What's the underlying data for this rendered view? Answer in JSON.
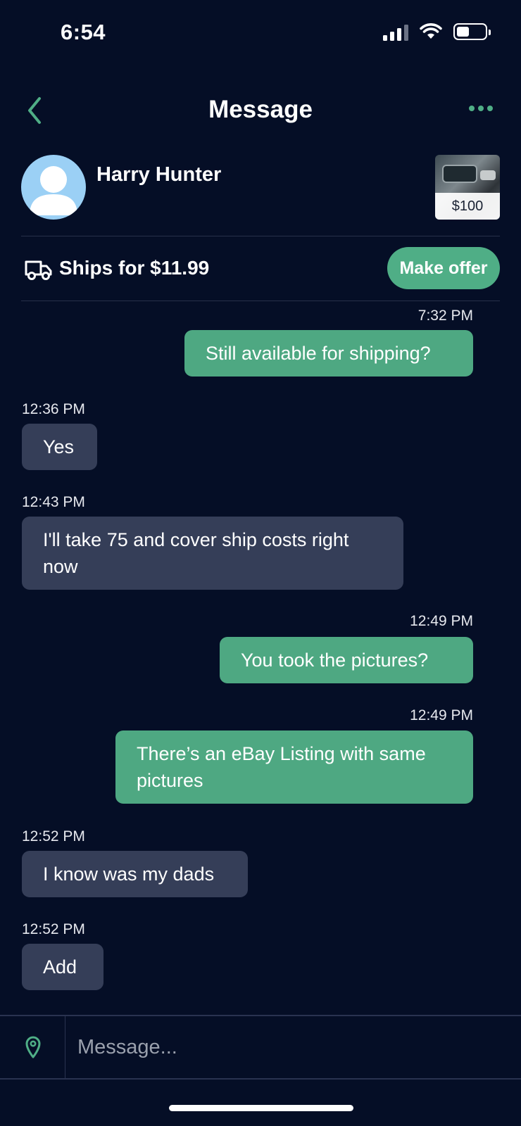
{
  "status_bar": {
    "time": "6:54"
  },
  "nav": {
    "title": "Message"
  },
  "seller": {
    "name": "Harry Hunter",
    "listing_price": "$100"
  },
  "shipping": {
    "text": "Ships for $11.99",
    "offer_label": "Make offer"
  },
  "messages": [
    {
      "direction": "outgoing",
      "time": "7:32 PM",
      "text": "Still available for shipping?"
    },
    {
      "direction": "incoming",
      "time": "12:36 PM",
      "text": "Yes"
    },
    {
      "direction": "incoming",
      "time": "12:43 PM",
      "text": "I'll take 75 and cover ship costs right now"
    },
    {
      "direction": "outgoing",
      "time": "12:49 PM",
      "text": "You took the pictures?"
    },
    {
      "direction": "outgoing",
      "time": "12:49 PM",
      "text": "There’s an eBay Listing with same pictures"
    },
    {
      "direction": "incoming",
      "time": "12:52 PM",
      "text": "I know was my dads"
    },
    {
      "direction": "incoming",
      "time": "12:52 PM",
      "text": "Add"
    }
  ],
  "composer": {
    "placeholder": "Message..."
  },
  "colors": {
    "background": "#050e26",
    "accent": "#4fae86",
    "incoming_bubble": "#353e58",
    "outgoing_bubble": "#4ea882"
  },
  "icons": [
    "back-chevron-icon",
    "more-dots-icon",
    "truck-icon",
    "location-pin-icon",
    "signal-icon",
    "wifi-icon",
    "battery-icon"
  ]
}
